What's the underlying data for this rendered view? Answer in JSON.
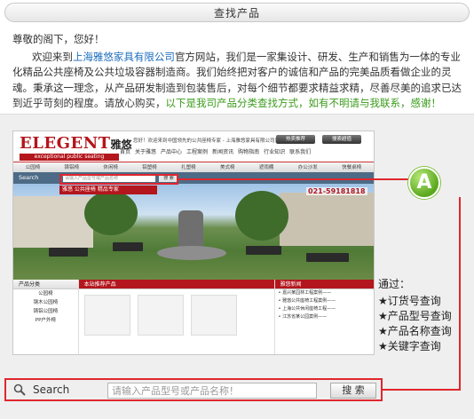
{
  "header": {
    "title": "查找产品"
  },
  "intro": {
    "greeting": "尊敬的阁下，您好！",
    "p_lead": "欢迎来到",
    "company": "上海雅悠家具有限公司",
    "p_body": "官方网站，我们是一家集设计、研发、生产和销售为一体的专业化精品公共座椅及公共垃圾容器制造商。我们始终把对客户的诚信和产品的完美品质看做企业的灵魂。秉承这一理念，从产品研发制造到包装售后，对每个细节都要求精益求精，尽善尽美的追求已达到近乎苛刻的程度。请放心购买，",
    "highlight": "以下是我司产品分类查找方式，如有不明请与我联系，感谢！"
  },
  "mini_site": {
    "logo_en": "ELEGENT",
    "logo_cn": "雅悠",
    "logo_sub": "exceptional public seating",
    "notice": "• 您好！欢迎来到中国领先的公共座椅专家 - 上海雅悠家具有限公司官方网站！",
    "buttons": [
      "热卖推荐",
      "搜索超值"
    ],
    "nav": [
      "首页",
      "关于雅悠",
      "产品中心",
      "工程案例",
      "新闻资讯",
      "购物指南",
      "行业知识",
      "联系我们"
    ],
    "cats": [
      "公园椅",
      "铸铝椅",
      "休闲椅",
      "铝塑椅",
      "扎塑椅",
      "美式椅",
      "遮雨棚",
      "办公沙发",
      "快餐桌椅"
    ],
    "search_label": "Search",
    "search_placeholder": "请输入产品型号或产品名称",
    "search_button": "搜 索",
    "banner": "雅悠 公共座椅 精品专家",
    "tel": "021-59181818",
    "col1_title": "产品分类",
    "col1_items": [
      "公园椅",
      "钢木公园椅",
      "铸铝公园椅",
      "PP户外椅"
    ],
    "col2_title": "本站推荐产品",
    "col3_title": "雅悠新闻",
    "col3_items": [
      "• 嘉兴某园林工程案例——",
      "• 雅悠公共座椅工程案例——",
      "• 上海公共休闲座椅工程——",
      "• 江苏省某公园案例——"
    ]
  },
  "badge": {
    "letter": "A"
  },
  "via": {
    "title": "通过：",
    "items": [
      "★订货号查询",
      "★产品型号查询",
      "★产品名称查询",
      "★关键字查询"
    ]
  },
  "search": {
    "label": "Search",
    "placeholder": "请输入产品型号或产品名称！",
    "button": "搜 索"
  },
  "colors": {
    "accent_red": "#e0262c",
    "brand_red": "#b3161c",
    "link_blue": "#1a6bbd",
    "highlight_green": "#3a9a1a",
    "badge_green": "#5aa81c"
  }
}
